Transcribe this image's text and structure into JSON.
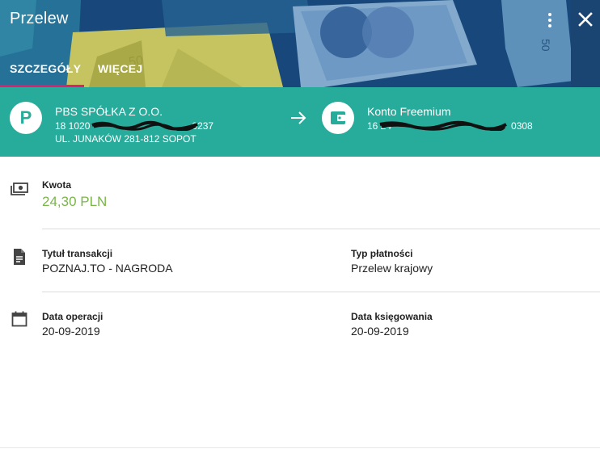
{
  "header": {
    "title": "Przelew",
    "tabs": [
      {
        "label": "SZCZEGÓŁY",
        "active": true
      },
      {
        "label": "WIĘCEJ",
        "active": false
      }
    ],
    "menu_icon": "more-vertical-icon",
    "close_icon": "close-icon",
    "accent_color": "#e31e6e",
    "background_color": "#1b4f86"
  },
  "transfer": {
    "from": {
      "initial": "P",
      "name": "PBS SPÓŁKA Z O.O.",
      "account_start": "18 1020",
      "account_end": "0237",
      "address": "UL. JUNAKÓW 281-812 SOPOT"
    },
    "to": {
      "icon": "wallet-icon",
      "name": "Konto Freemium",
      "account_start": "16 24",
      "account_end": "0308"
    },
    "arrow_icon": "arrow-right-icon",
    "band_color": "#27ab9a"
  },
  "details": {
    "amount": {
      "label": "Kwota",
      "value": "24,30 PLN",
      "color": "#7ab648",
      "icon": "money-icon"
    },
    "title": {
      "label": "Tytuł transakcji",
      "value": "POZNAJ.TO - NAGRODA",
      "icon": "document-icon"
    },
    "payment_type": {
      "label": "Typ płatności",
      "value": "Przelew krajowy"
    },
    "operation_date": {
      "label": "Data operacji",
      "value": "20-09-2019",
      "icon": "calendar-icon"
    },
    "booking_date": {
      "label": "Data księgowania",
      "value": "20-09-2019"
    }
  }
}
